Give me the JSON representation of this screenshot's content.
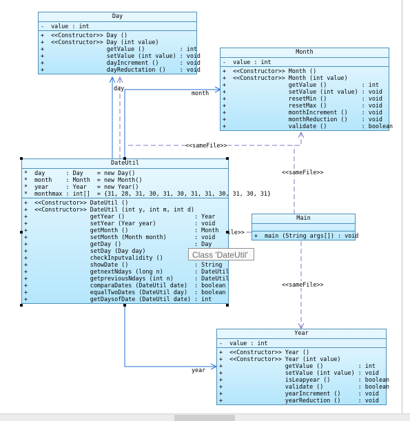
{
  "classes": {
    "day": {
      "name": "Day",
      "attributes": [
        "-  value : int"
      ],
      "methods": [
        "+  <<Constructor>> Day ()",
        "+  <<Constructor>> Day (int value)",
        "+                  getValue ()          : int",
        "+                  setValue (int value) : void",
        "+                  dayIncrement ()      : void",
        "+                  dayReductation ()    : void"
      ]
    },
    "month": {
      "name": "Month",
      "attributes": [
        "-  value : int"
      ],
      "methods": [
        "+  <<Constructor>> Month ()",
        "+  <<Constructor>> Month (int value)",
        "+                  getValue ()          : int",
        "+                  setValue (int value) : void",
        "+                  resetMin ()          : void",
        "+                  resetMax ()          : void",
        "+                  monthIncrement ()    : void",
        "+                  monthReduction ()    : void",
        "+                  validate ()          : boolean"
      ]
    },
    "dateutil": {
      "name": "DateUtil",
      "attributes": [
        "*  day      : Day    = new Day()",
        "*  month    : Month  = new Month()",
        "*  year     : Year   = new Year()",
        "*  monthmax : int[]  = {31, 28, 31, 30, 31, 30, 31, 31, 30, 31, 30, 31}"
      ],
      "methods": [
        "+  <<Constructor>> DateUtil ()",
        "+  <<Constructor>> DateUtil (int y, int m, int d)",
        "+                  getYear ()                    : Year",
        "+                  setYear (Year year)           : void",
        "+                  getMonth ()                   : Month",
        "+                  setMonth (Month month)        : void",
        "+                  getDay ()                     : Day",
        "+                  setDay (Day day)              : void",
        "+                  checkInputvalidity ()         : boolean",
        "+                  showDate ()                   : String",
        "+                  getnextNdays (long n)         : DateUtil",
        "+                  getpreviousNdays (int n)      : DateUtil",
        "+                  comparaDates (DateUtil date)  : boolean",
        "+                  equalTwoDates (DateUtil day)  : boolean",
        "+                  getDaysofDate (DateUtil date) : int"
      ]
    },
    "main": {
      "name": "Main",
      "attributes": [],
      "methods": [
        "+  main (String args[]) : void"
      ]
    },
    "year": {
      "name": "Year",
      "attributes": [
        "-  value : int"
      ],
      "methods": [
        "+  <<Constructor>> Year ()",
        "+  <<Constructor>> Year (int value)",
        "+                  getValue ()          : int",
        "+                  setValue (int value) : void",
        "+                  isLeapyear ()        : boolean",
        "+                  validate ()          : boolean",
        "+                  yearIncrement ()     : void",
        "+                  yearReduction ()     : void"
      ]
    }
  },
  "labels": {
    "day": "day",
    "month": "month",
    "year": "year",
    "samefile_top": "<<sameFile>>",
    "samefile_month": "<<sameFile>>",
    "samefile_year": "<<sameFile>>",
    "samefile_main": "<<sameFile>>"
  },
  "tooltip": "Class 'DateUtil'",
  "colors": {
    "association": "#1f6fd1",
    "dependency": "#7a7ac4",
    "border": "#4d8fb8"
  }
}
